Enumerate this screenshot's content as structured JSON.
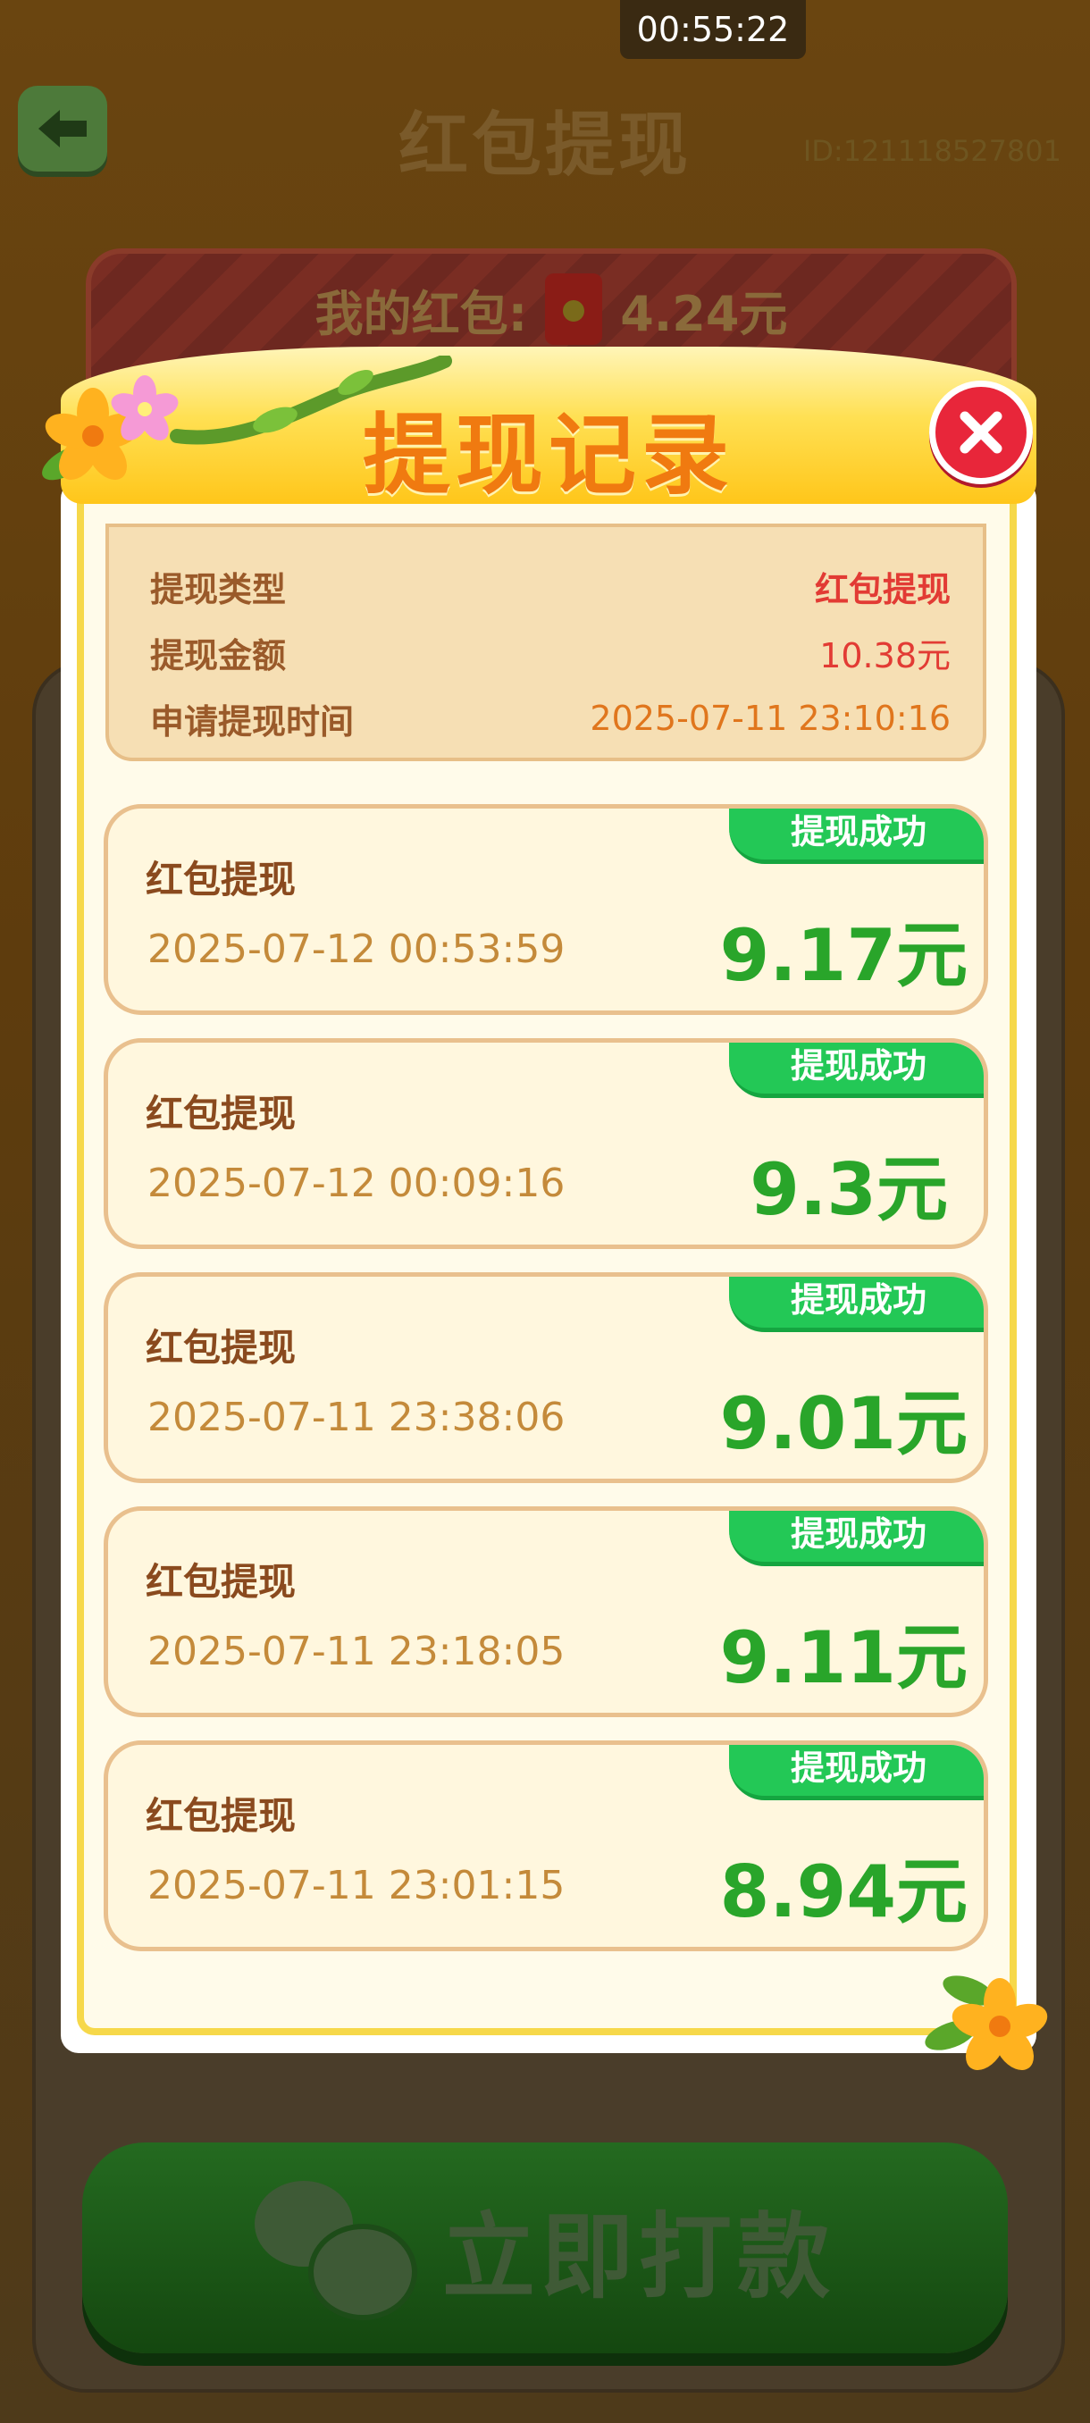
{
  "status": {
    "timer": "00:55:22"
  },
  "header": {
    "title": "红包提现",
    "user_id": "ID:121118527801"
  },
  "wallet": {
    "label": "我的红包:",
    "amount": "4.24元"
  },
  "pay_button": {
    "label": "立即打款"
  },
  "modal": {
    "title": "提现记录",
    "summary": {
      "rows": [
        {
          "key": "提现类型",
          "value": "红包提现"
        },
        {
          "key": "提现金额",
          "value": "10.38元"
        },
        {
          "key": "申请提现时间",
          "value": "2025-07-11 23:10:16"
        }
      ]
    },
    "records": [
      {
        "type": "红包提现",
        "time": "2025-07-12 00:53:59",
        "amount": "9.17元",
        "status": "提现成功"
      },
      {
        "type": "红包提现",
        "time": "2025-07-12 00:09:16",
        "amount": "9.3元",
        "status": "提现成功"
      },
      {
        "type": "红包提现",
        "time": "2025-07-11 23:38:06",
        "amount": "9.01元",
        "status": "提现成功"
      },
      {
        "type": "红包提现",
        "time": "2025-07-11 23:18:05",
        "amount": "9.11元",
        "status": "提现成功"
      },
      {
        "type": "红包提现",
        "time": "2025-07-11 23:01:15",
        "amount": "8.94元",
        "status": "提现成功"
      }
    ]
  },
  "colors": {
    "success_green": "#23c856",
    "amount_green": "#29a52a",
    "accent_orange": "#f07a10",
    "close_red": "#e8263a"
  },
  "icons": {
    "back": "arrow-left-icon",
    "close": "close-icon",
    "wechat": "wechat-icon",
    "red_envelope": "red-envelope-icon",
    "flower": "flower-icon"
  }
}
